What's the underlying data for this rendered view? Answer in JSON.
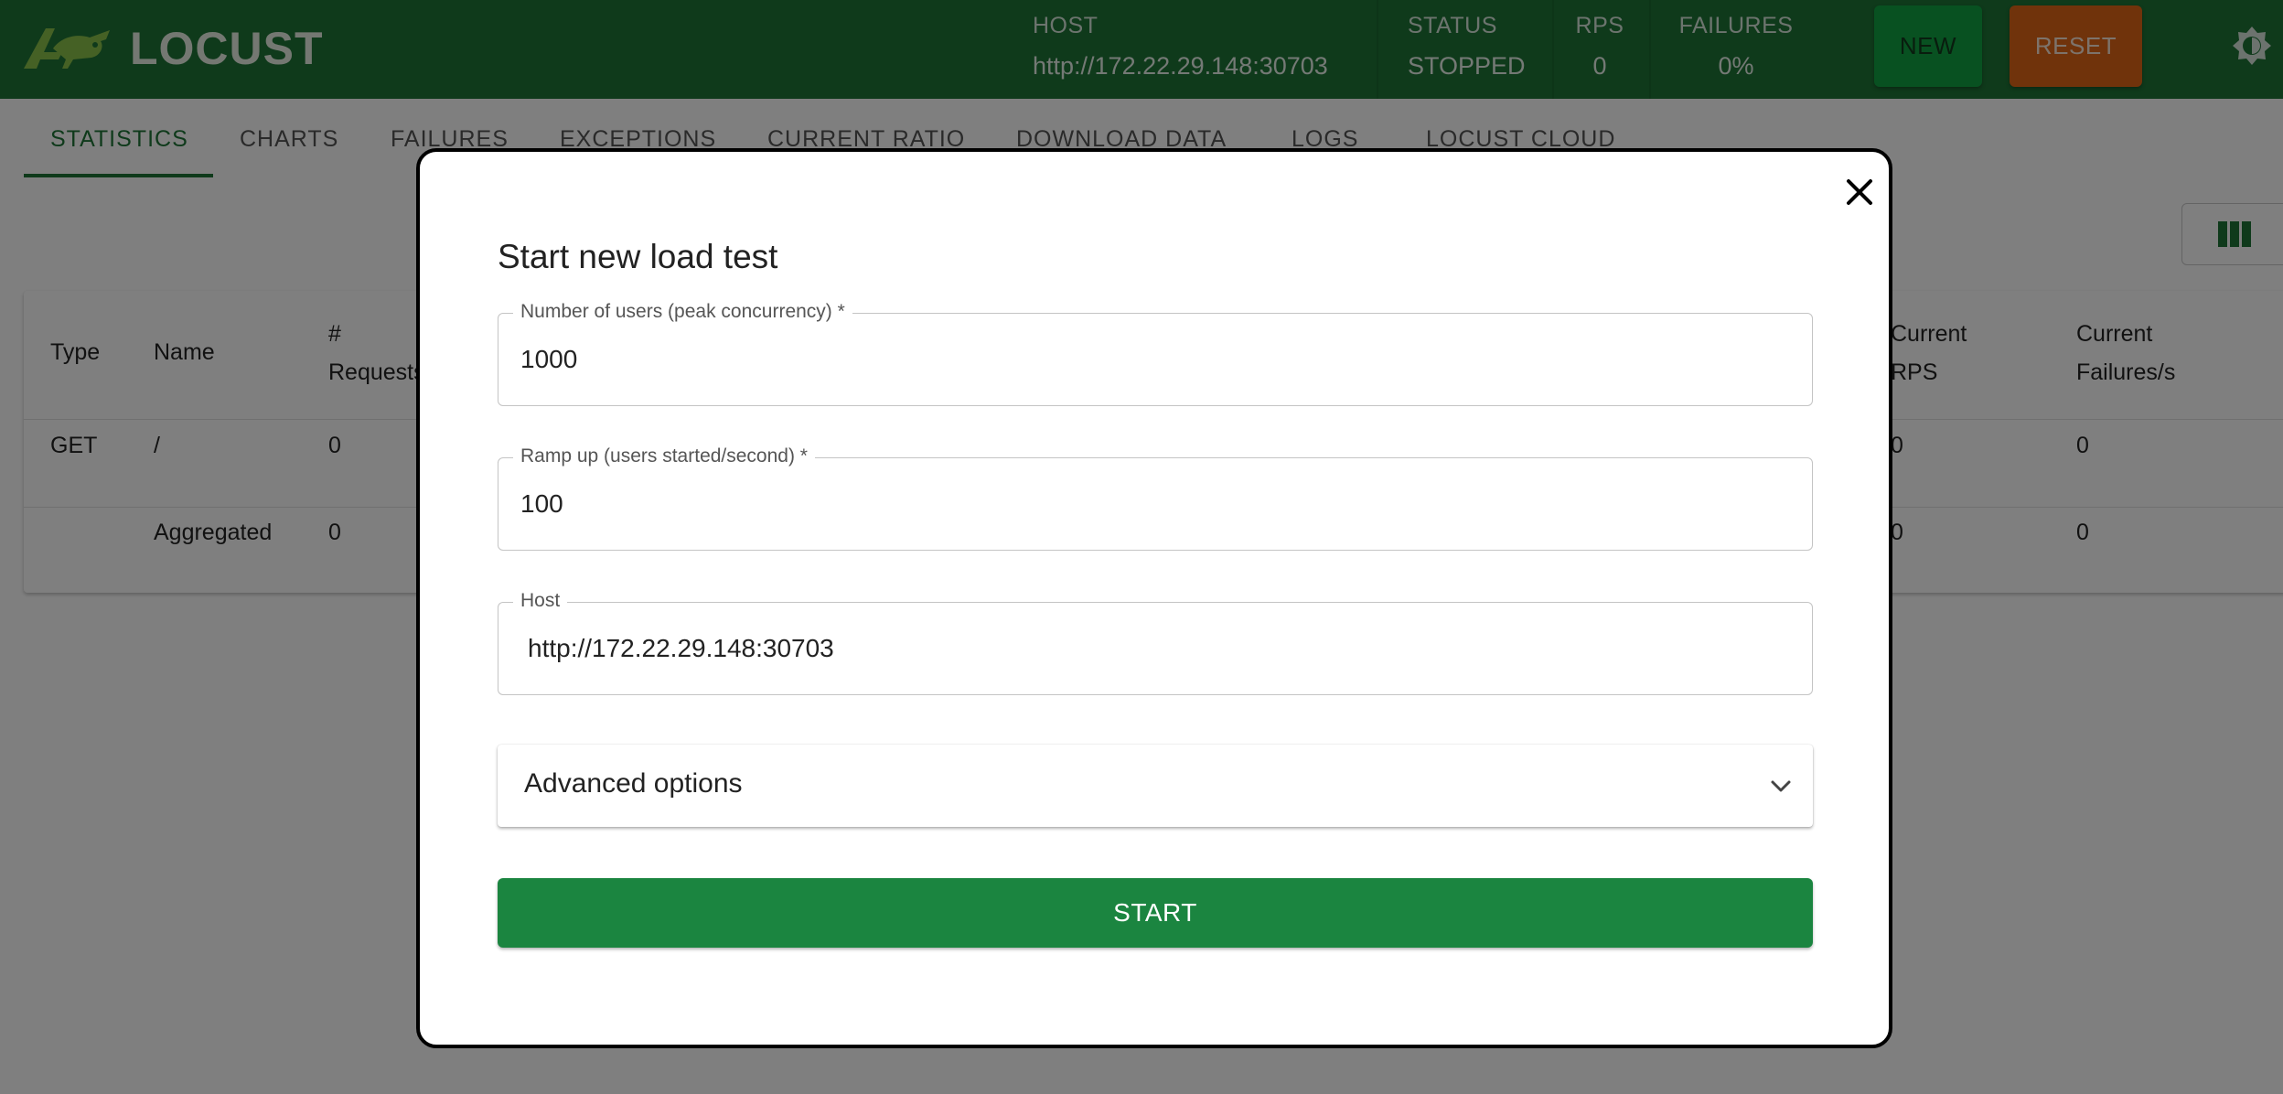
{
  "header": {
    "logo_text": "LOCUST",
    "host_label": "HOST",
    "host_value": "http://172.22.29.148:30703",
    "status_label": "STATUS",
    "status_value": "STOPPED",
    "rps_label": "RPS",
    "rps_value": "0",
    "failures_label": "FAILURES",
    "failures_value": "0%",
    "new_label": "NEW",
    "reset_label": "RESET"
  },
  "tabs": [
    "STATISTICS",
    "CHARTS",
    "FAILURES",
    "EXCEPTIONS",
    "CURRENT RATIO",
    "DOWNLOAD DATA",
    "LOGS",
    "LOCUST CLOUD"
  ],
  "table": {
    "headers": {
      "type": "Type",
      "name": "Name",
      "requests_1": "#",
      "requests_2": "Requests",
      "rps_1": "Current",
      "rps_2": "RPS",
      "failures_1": "Current",
      "failures_2": "Failures/s"
    },
    "rows": [
      {
        "type": "GET",
        "name": "/",
        "requests": "0",
        "rps": "0",
        "failures": "0"
      },
      {
        "type": "",
        "name": "Aggregated",
        "requests": "0",
        "rps": "0",
        "failures": "0"
      }
    ]
  },
  "modal": {
    "title": "Start new load test",
    "users_label": "Number of users (peak concurrency) *",
    "users_value": "1000",
    "ramp_label": "Ramp up (users started/second) *",
    "ramp_value": "100",
    "host_label": "Host",
    "host_value": "http://172.22.29.148:30703",
    "advanced_label": "Advanced options",
    "start_label": "START"
  },
  "colors": {
    "brand_green": "#1e7436",
    "new_button": "#10a243",
    "reset_button": "#e06716",
    "start_button": "#1b8540"
  }
}
